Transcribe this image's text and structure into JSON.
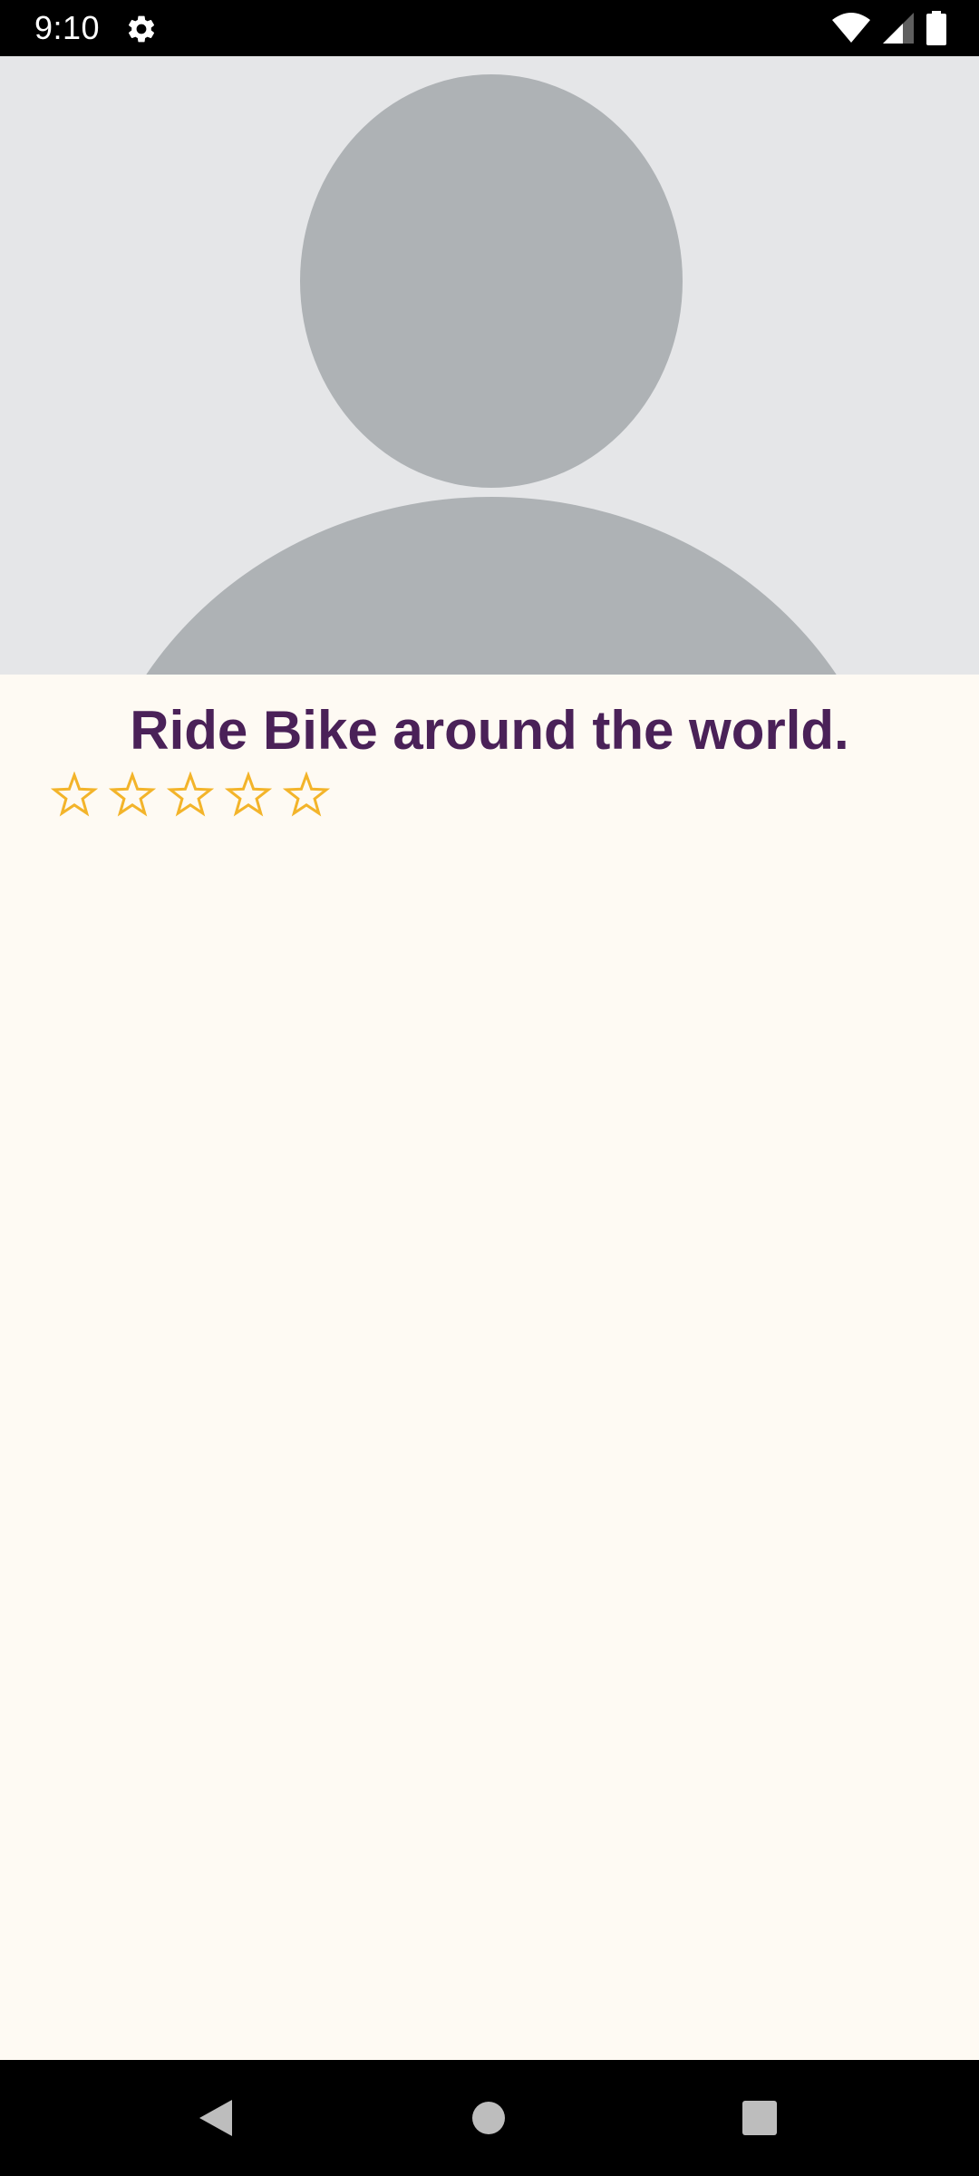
{
  "status_bar": {
    "time": "9:10",
    "icons": [
      "settings-gear-icon",
      "wifi-icon",
      "cellular-signal-icon",
      "battery-icon"
    ]
  },
  "hero": {
    "icon": "person-placeholder-icon",
    "colors": {
      "background": "#e5e6e8",
      "silhouette": "#aeb2b5"
    }
  },
  "content": {
    "title": "Ride Bike around the world.",
    "rating": {
      "value": 0,
      "max": 5
    }
  },
  "nav_bar": {
    "icons": [
      "back-icon",
      "home-icon",
      "recents-icon"
    ]
  },
  "colors": {
    "title": "#4a2158",
    "star": "#f3b42a",
    "page_background": "#fefaf3"
  }
}
